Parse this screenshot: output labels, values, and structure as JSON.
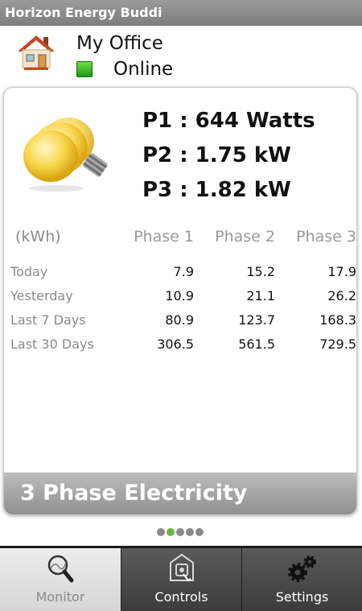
{
  "app": {
    "title": "Horizon Energy Buddi"
  },
  "site": {
    "name": "My Office",
    "status": "Online",
    "status_color": "#2fbf1f",
    "icon": "house-icon"
  },
  "power": {
    "icon": "light-bulb-icon",
    "readings": [
      "P1 : 644 Watts",
      "P2 : 1.75 kW",
      "P3 : 1.82 kW"
    ]
  },
  "energy_table": {
    "unit": "(kWh)",
    "columns": [
      "Phase 1",
      "Phase 2",
      "Phase 3"
    ],
    "rows": [
      {
        "label": "Today",
        "values": [
          "7.9",
          "15.2",
          "17.9"
        ]
      },
      {
        "label": "Yesterday",
        "values": [
          "10.9",
          "21.1",
          "26.2"
        ]
      },
      {
        "label": "Last 7 Days",
        "values": [
          "80.9",
          "123.7",
          "168.3"
        ]
      },
      {
        "label": "Last 30 Days",
        "values": [
          "306.5",
          "561.5",
          "729.5"
        ]
      }
    ]
  },
  "card_footer": "3 Phase Electricity",
  "pager": {
    "count": 5,
    "active_index": 1,
    "active_color": "#6db33f"
  },
  "tabs": [
    {
      "label": "Monitor",
      "icon": "magnifier-icon",
      "selected": true
    },
    {
      "label": "Controls",
      "icon": "controls-icon",
      "selected": false
    },
    {
      "label": "Settings",
      "icon": "gears-icon",
      "selected": false
    }
  ]
}
